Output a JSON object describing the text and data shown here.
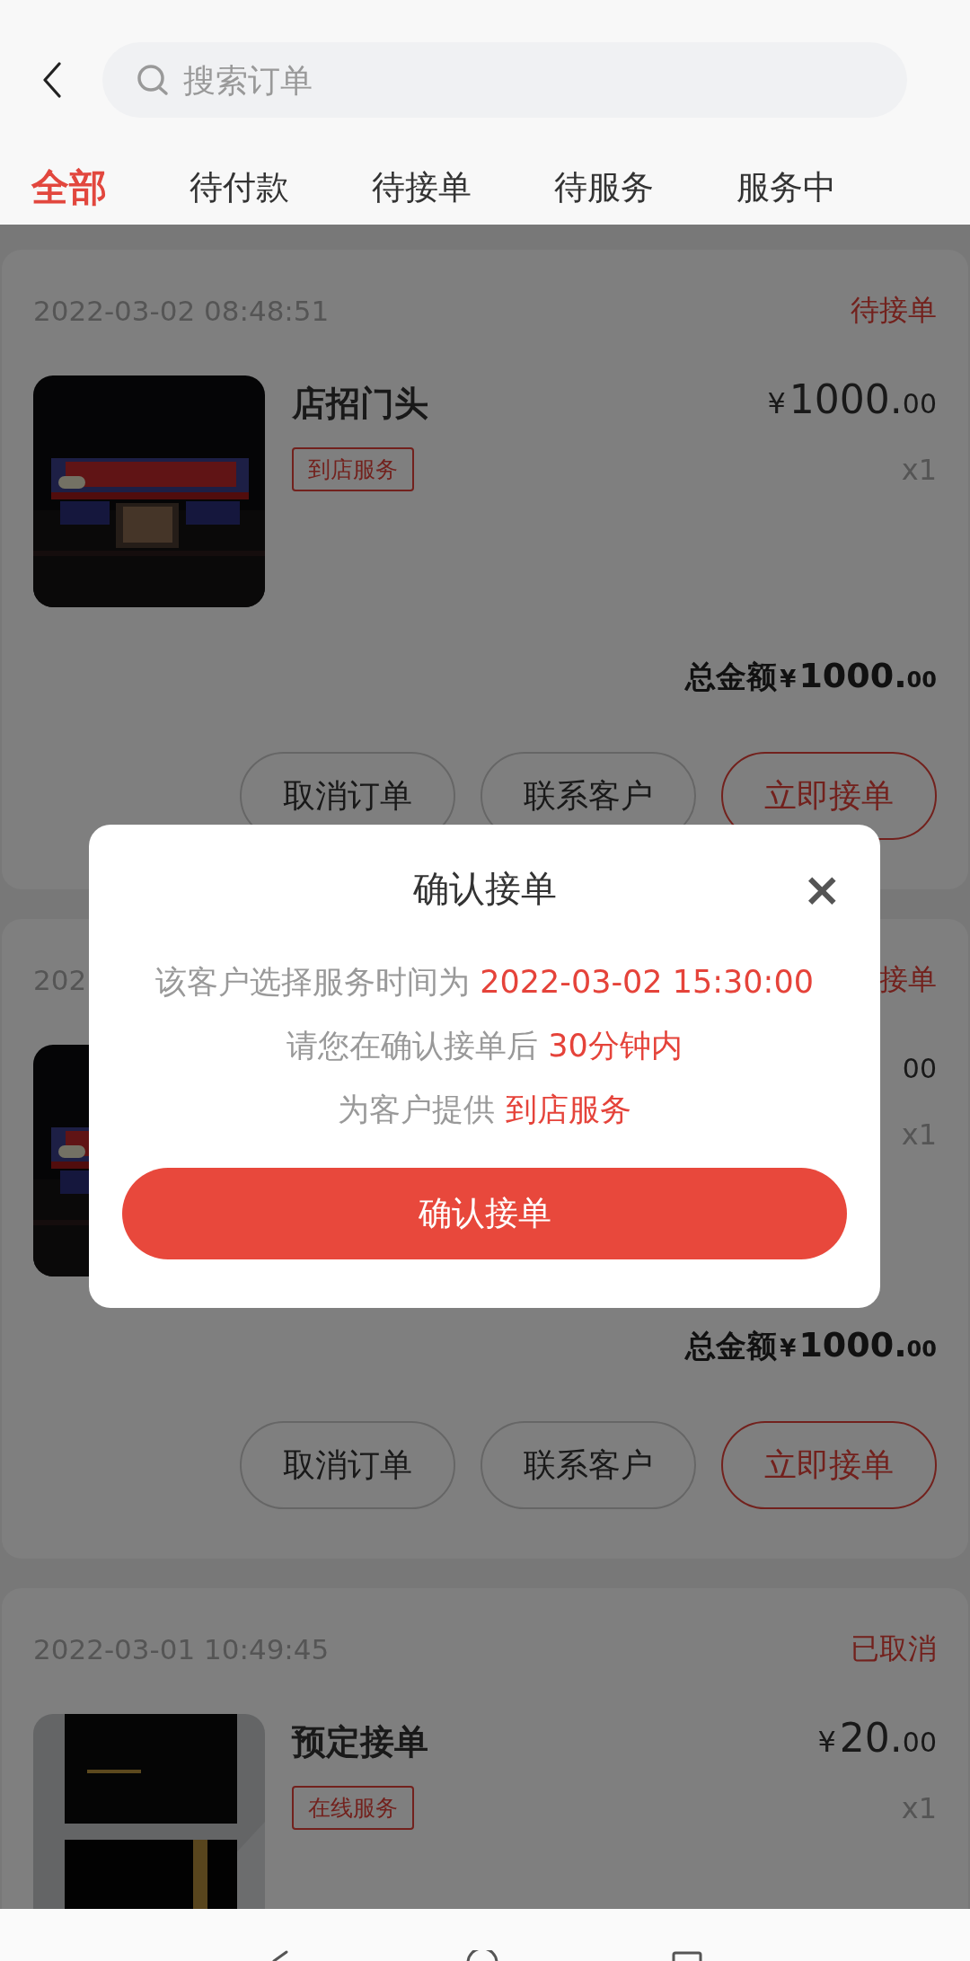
{
  "search": {
    "placeholder": "搜索订单"
  },
  "tabs": [
    {
      "label": "全部",
      "selected": true
    },
    {
      "label": "待付款",
      "selected": false
    },
    {
      "label": "待接单",
      "selected": false
    },
    {
      "label": "待服务",
      "selected": false
    },
    {
      "label": "服务中",
      "selected": false
    }
  ],
  "orders": [
    {
      "date": "2022-03-02 08:48:51",
      "status": "待接单",
      "title": "店招门头",
      "tag": "到店服务",
      "price": {
        "currency": "¥",
        "main": "1000.",
        "cents": "00"
      },
      "quantity": "x1",
      "total": {
        "label": "总金额",
        "currency": "¥",
        "main": "1000.",
        "cents": "00"
      },
      "buttons": [
        {
          "label": "取消订单",
          "primary": false
        },
        {
          "label": "联系客户",
          "primary": false
        },
        {
          "label": "立即接单",
          "primary": true
        }
      ]
    },
    {
      "date": "202",
      "status": "接单",
      "price": {
        "cents": "00"
      },
      "quantity": "x1",
      "total": {
        "label": "总金额",
        "currency": "¥",
        "main": "1000.",
        "cents": "00"
      },
      "buttons": [
        {
          "label": "取消订单",
          "primary": false
        },
        {
          "label": "联系客户",
          "primary": false
        },
        {
          "label": "立即接单",
          "primary": true
        }
      ]
    },
    {
      "date": "2022-03-01 10:49:45",
      "status": "已取消",
      "title": "预定接单",
      "tag": "在线服务",
      "price": {
        "currency": "¥",
        "main": "20.",
        "cents": "00"
      },
      "quantity": "x1"
    }
  ],
  "dialog": {
    "title": "确认接单",
    "close": "×",
    "lines": [
      {
        "text": "该客户选择服务时间为",
        "highlight": "2022-03-02 15:30:00"
      },
      {
        "text": "请您在确认接单后",
        "highlight": "30分钟内"
      },
      {
        "text": "为客户提供",
        "highlight": "到店服务"
      }
    ],
    "button": "确认接单"
  }
}
